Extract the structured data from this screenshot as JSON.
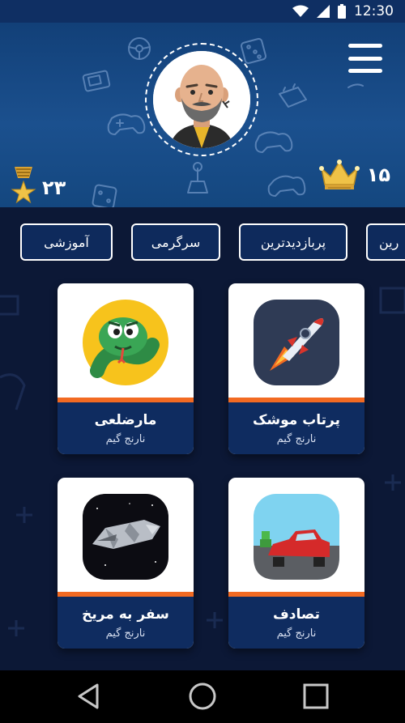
{
  "status_bar": {
    "time": "12:30"
  },
  "header": {
    "medals_count": "۲۳",
    "crowns_count": "۱۵"
  },
  "tabs": [
    {
      "label": "آموزشی"
    },
    {
      "label": "سرگرمی"
    },
    {
      "label": "پربازدیدترین"
    },
    {
      "label": "رین"
    }
  ],
  "games": [
    {
      "title": "پرتاب موشک",
      "publisher": "نارنج گیم",
      "icon": "rocket-icon"
    },
    {
      "title": "مارضلعی",
      "publisher": "نارنج گیم",
      "icon": "snake-icon"
    },
    {
      "title": "تصادف",
      "publisher": "نارنج گیم",
      "icon": "car-crash-icon"
    },
    {
      "title": "سفر به مریخ",
      "publisher": "نارنج گیم",
      "icon": "spaceship-icon"
    }
  ],
  "colors": {
    "header_blue": "#1b508e",
    "card_footer": "#0f2c60",
    "accent_orange": "#f26a22",
    "background": "#0c1836",
    "gold": "#f0c247"
  }
}
